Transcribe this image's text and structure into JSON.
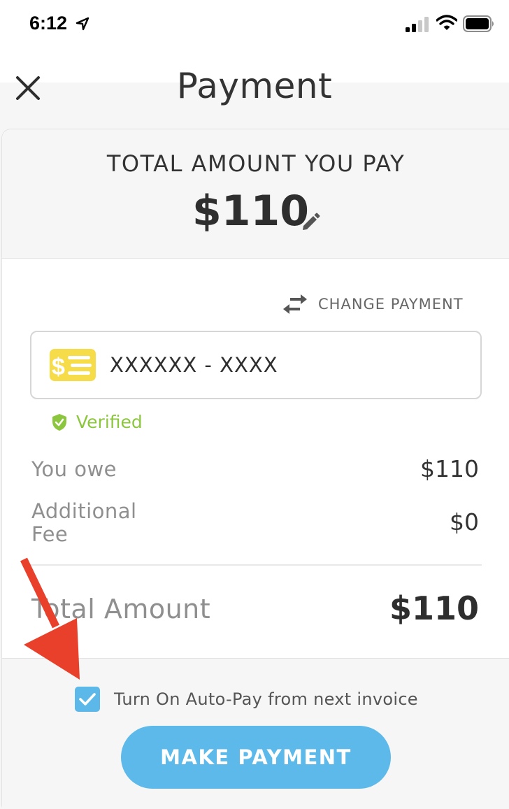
{
  "status_bar": {
    "time": "6:12",
    "icons": [
      "location-arrow-icon",
      "cellular-signal-icon",
      "wifi-icon",
      "battery-icon"
    ]
  },
  "header": {
    "title": "Payment",
    "close_icon": "close-icon"
  },
  "summary": {
    "label": "TOTAL AMOUNT YOU PAY",
    "amount": "$110",
    "edit_icon": "pencil-icon"
  },
  "payment_method": {
    "change_label": "CHANGE PAYMENT",
    "account_masked": "XXXXXX - XXXX",
    "verified_label": "Verified",
    "icon": "bank-account-icon"
  },
  "breakdown": {
    "rows": [
      {
        "label": "You owe",
        "value": "$110"
      },
      {
        "label": "Additional\nFee",
        "value": "$0"
      }
    ],
    "total_label": "Total Amount",
    "total_value": "$110"
  },
  "footer": {
    "autopay_label": "Turn On Auto-Pay from next invoice",
    "autopay_checked": true,
    "make_payment_label": "MAKE PAYMENT"
  },
  "colors": {
    "accent": "#5cb9e9",
    "verified": "#8cc63f",
    "bank_icon": "#f7dc4a",
    "annotation_arrow": "#e8402a"
  }
}
